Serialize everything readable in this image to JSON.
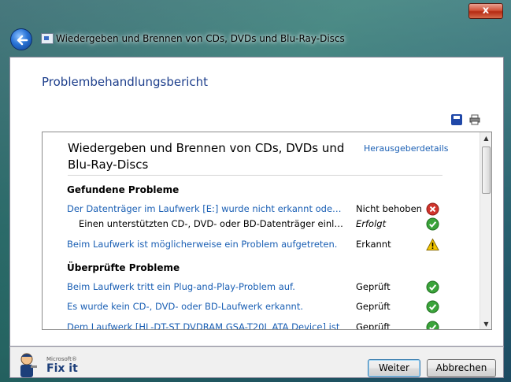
{
  "window": {
    "title": "Wiedergeben und Brennen von CDs, DVDs und Blu-Ray-Discs",
    "close_glyph": "x"
  },
  "header": {
    "title": "Problembehandlungsbericht"
  },
  "report": {
    "title": "Wiedergeben und Brennen von CDs, DVDs und Blu-Ray-Discs",
    "publisher_link": "Herausgeberdetails",
    "found_section": {
      "heading": "Gefundene Probleme",
      "rows": [
        {
          "text": "Der Datenträger im Laufwerk [E:] wurde nicht erkannt oder wir...",
          "status": "Nicht behoben",
          "icon": "error-x-icon"
        },
        {
          "text": "Einen unterstützten CD-, DVD- oder BD-Datenträger einlegen",
          "status": "Erfolgt",
          "icon": "success-check-icon"
        },
        {
          "text": "Beim Laufwerk ist möglicherweise ein Problem aufgetreten.",
          "status": "Erkannt",
          "icon": "warning-icon"
        }
      ]
    },
    "checked_section": {
      "heading": "Überprüfte Probleme",
      "rows": [
        {
          "text": "Beim Laufwerk tritt ein Plug-and-Play-Problem auf.",
          "status": "Geprüft",
          "icon": "success-check-icon"
        },
        {
          "text": "Es wurde kein CD-, DVD- oder BD-Laufwerk erkannt.",
          "status": "Geprüft",
          "icon": "success-check-icon"
        },
        {
          "text": "Dem Laufwerk [HL-DT-ST DVDRAM GSA-T20L ATA Device] ist",
          "status": "Geprüft",
          "icon": "success-check-icon"
        }
      ]
    }
  },
  "footer": {
    "logo_small": "Microsoft®",
    "logo_big": "Fix it",
    "next_label": "Weiter",
    "cancel_label": "Abbrechen"
  },
  "colors": {
    "link": "#1a5fb4",
    "header": "#1e3f8c",
    "error": "#d0342c",
    "success": "#3aa33a",
    "warning": "#f2c500"
  }
}
